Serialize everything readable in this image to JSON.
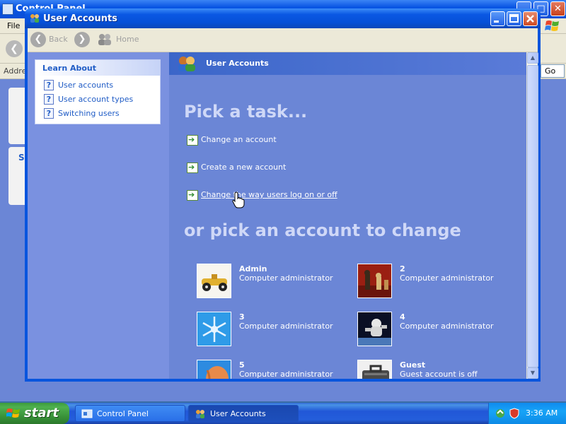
{
  "background_window": {
    "title": "Control Panel",
    "menu_file": "File",
    "address_label": "Address",
    "go_label": "Go",
    "sidebar_heading_fragment": "Se"
  },
  "window": {
    "title": "User Accounts"
  },
  "toolbar": {
    "back_label": "Back",
    "home_label": "Home"
  },
  "learn_about": {
    "title": "Learn About",
    "items": [
      {
        "label": "User accounts",
        "icon": "help-icon"
      },
      {
        "label": "User account types",
        "icon": "help-icon"
      },
      {
        "label": "Switching users",
        "icon": "help-icon"
      }
    ]
  },
  "main": {
    "header_title": "User Accounts",
    "pick_task_heading": "Pick a task...",
    "tasks": [
      {
        "label": "Change an account",
        "icon": "green-arrow-icon"
      },
      {
        "label": "Create a new account",
        "icon": "green-arrow-icon"
      },
      {
        "label": "Change the way users log on or off",
        "icon": "green-arrow-icon",
        "hovered": true
      }
    ],
    "pick_account_heading": "or pick an account to change",
    "accounts": [
      {
        "name": "Admin",
        "type": "Computer administrator",
        "picture": "race-car-picture"
      },
      {
        "name": "2",
        "type": "Computer administrator",
        "picture": "chess-pieces-picture"
      },
      {
        "name": "3",
        "type": "Computer administrator",
        "picture": "snowflake-picture"
      },
      {
        "name": "4",
        "type": "Computer administrator",
        "picture": "astronaut-picture"
      },
      {
        "name": "5",
        "type": "Computer administrator",
        "picture": "fish-picture"
      },
      {
        "name": "Guest",
        "type": "Guest account is off",
        "picture": "suitcase-picture"
      }
    ]
  },
  "taskbar": {
    "start_label": "start",
    "buttons": [
      {
        "label": "Control Panel",
        "active": false
      },
      {
        "label": "User Accounts",
        "active": true
      }
    ],
    "clock": "3:36 AM"
  },
  "colors": {
    "title_bar": "#0a58e3",
    "task_pane": "#6b86d6",
    "left_pane": "#7a91e0",
    "link_blue": "#215dc6",
    "start_green": "#3c9a3c",
    "close_red": "#cf4a22"
  }
}
